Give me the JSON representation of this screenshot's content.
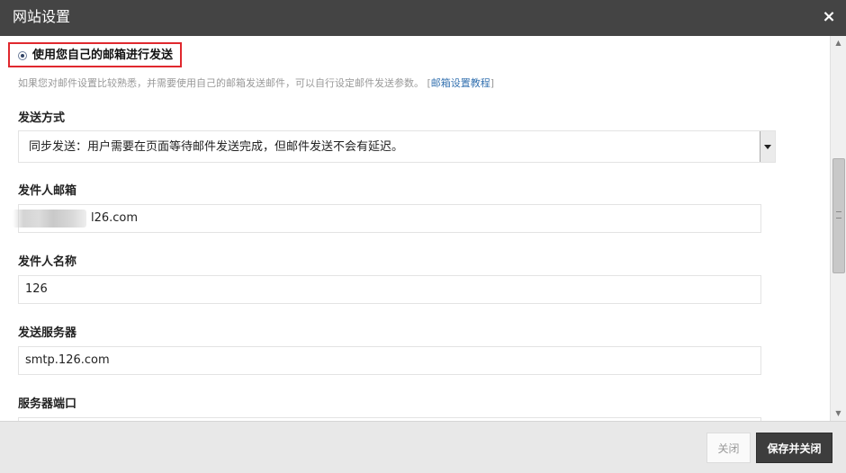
{
  "dialog": {
    "title": "网站设置",
    "close_glyph": "×"
  },
  "mail": {
    "radio_label": "使用您自己的邮箱进行发送",
    "radio_checked": true,
    "description": "如果您对邮件设置比较熟悉，并需要使用自己的邮箱发送邮件，可以自行设定邮件发送参数。",
    "tutorial_open": "[",
    "tutorial_link": "邮箱设置教程",
    "tutorial_close": "]"
  },
  "fields": {
    "send_mode_label": "发送方式",
    "send_mode_value": "同步发送：用户需要在页面等待邮件发送完成，但邮件发送不会有延迟。",
    "sender_email_label": "发件人邮箱",
    "sender_email_value": "l26.com",
    "sender_name_label": "发件人名称",
    "sender_name_value": "126",
    "smtp_server_label": "发送服务器",
    "smtp_server_value": "smtp.126.com",
    "server_port_label": "服务器端口"
  },
  "footer": {
    "close_label": "关闭",
    "save_label": "保存并关闭"
  },
  "icons": {
    "close": "close-icon",
    "dropdown": "chevron-down-icon",
    "scroll_up": "arrow-up-icon",
    "scroll_down": "arrow-down-icon"
  },
  "colors": {
    "titlebar": "#444444",
    "highlight_border": "#e0282e",
    "link": "#3572b0",
    "primary_button": "#3d3d3d"
  }
}
